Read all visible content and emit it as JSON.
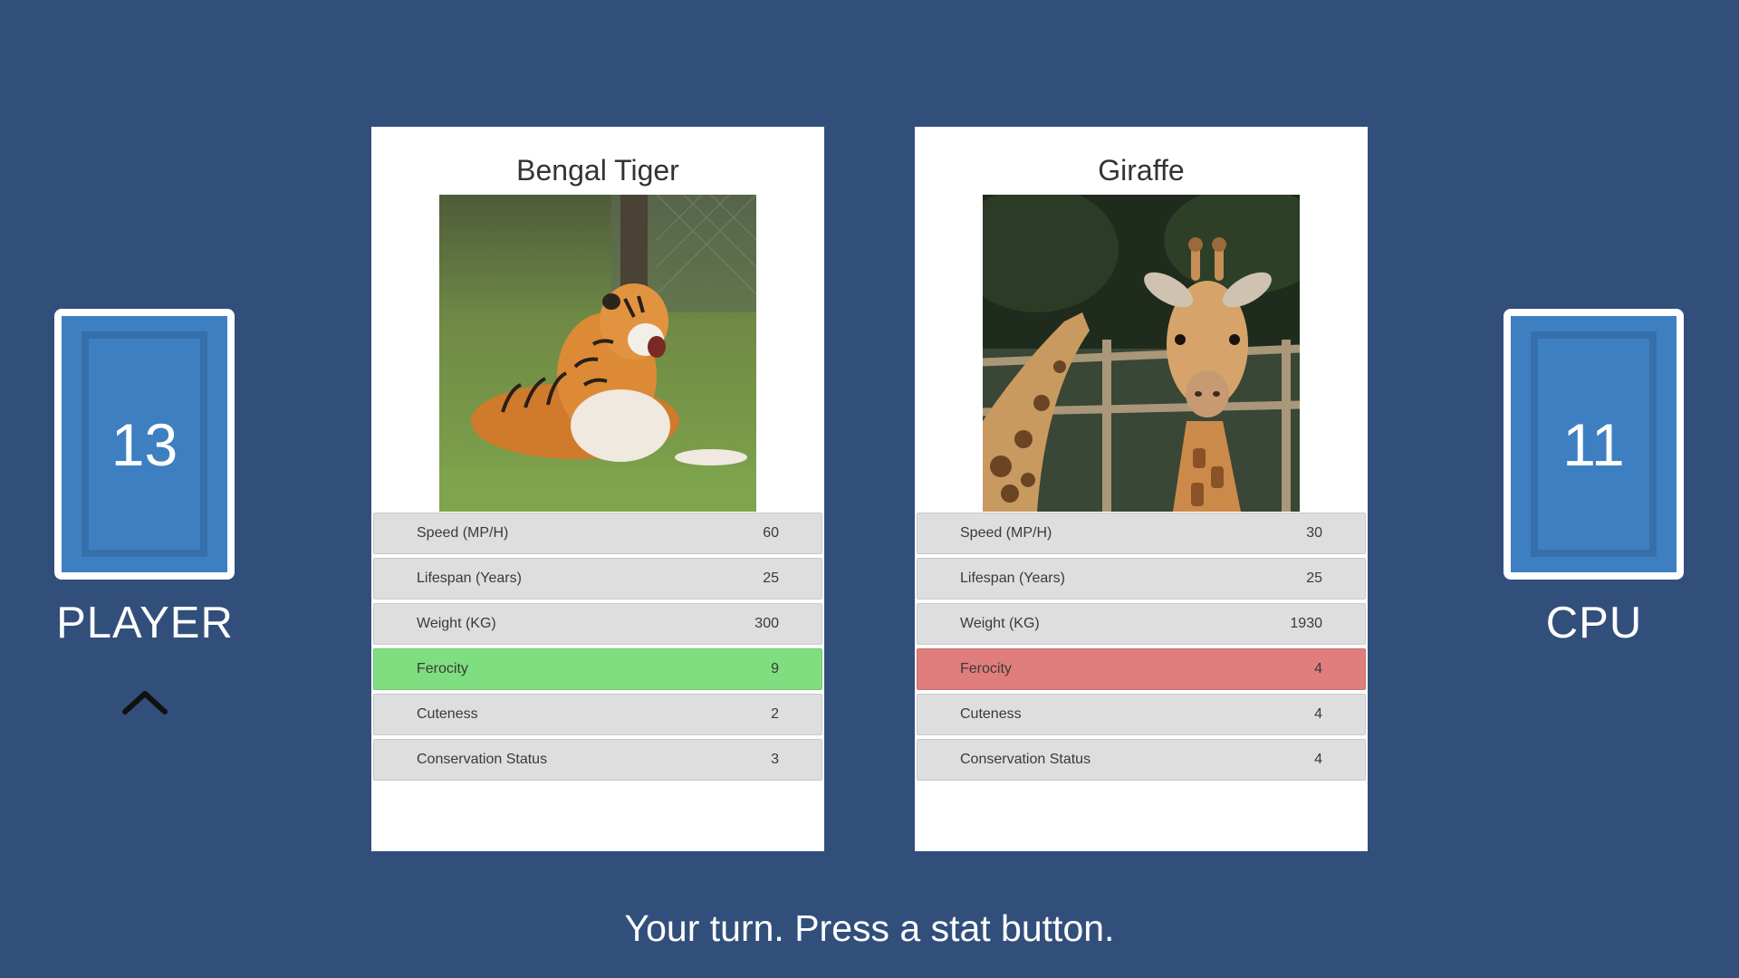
{
  "player": {
    "label": "PLAYER",
    "card_count": "13"
  },
  "cpu": {
    "label": "CPU",
    "card_count": "11"
  },
  "status_message": "Your turn. Press a stat button.",
  "colors": {
    "background": "#324f7b",
    "deck_face": "#3e7fc1",
    "stat_default": "#dedede",
    "stat_win": "#7fde7f",
    "stat_lose": "#e07d7d"
  },
  "player_card": {
    "name": "Bengal Tiger",
    "image": "tiger-photo",
    "stats": [
      {
        "label": "Speed (MP/H)",
        "value": "60",
        "state": "default"
      },
      {
        "label": "Lifespan (Years)",
        "value": "25",
        "state": "default"
      },
      {
        "label": "Weight (KG)",
        "value": "300",
        "state": "default"
      },
      {
        "label": "Ferocity",
        "value": "9",
        "state": "win"
      },
      {
        "label": "Cuteness",
        "value": "2",
        "state": "default"
      },
      {
        "label": "Conservation Status",
        "value": "3",
        "state": "default"
      }
    ]
  },
  "cpu_card": {
    "name": "Giraffe",
    "image": "giraffe-photo",
    "stats": [
      {
        "label": "Speed (MP/H)",
        "value": "30",
        "state": "default"
      },
      {
        "label": "Lifespan (Years)",
        "value": "25",
        "state": "default"
      },
      {
        "label": "Weight (KG)",
        "value": "1930",
        "state": "default"
      },
      {
        "label": "Ferocity",
        "value": "4",
        "state": "lose"
      },
      {
        "label": "Cuteness",
        "value": "4",
        "state": "default"
      },
      {
        "label": "Conservation Status",
        "value": "4",
        "state": "default"
      }
    ]
  }
}
